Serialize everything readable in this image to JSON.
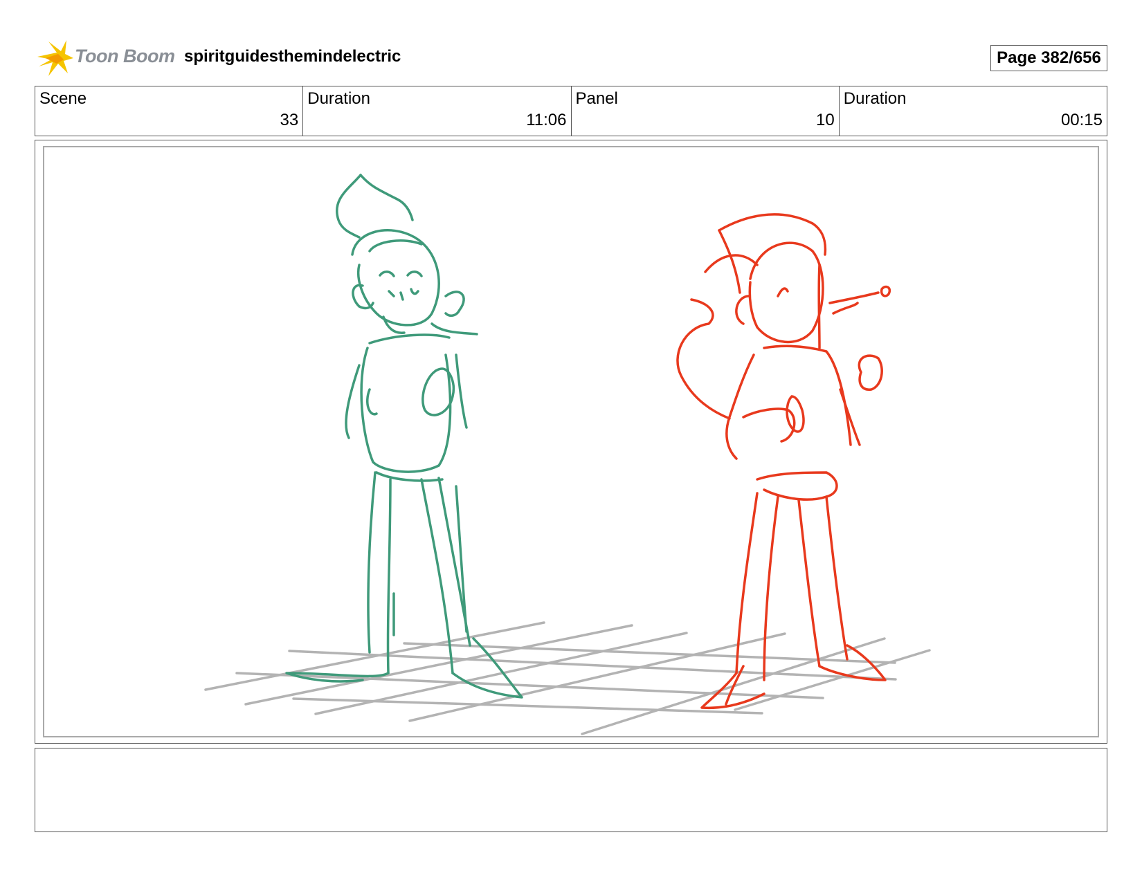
{
  "header": {
    "logo_text": "Toon Boom",
    "project_title": "spiritguidesthemindelectric",
    "page_label": "Page 382/656"
  },
  "info": {
    "scene_label": "Scene",
    "scene_value": "33",
    "scene_duration_label": "Duration",
    "scene_duration_value": "11:06",
    "panel_label": "Panel",
    "panel_value": "10",
    "panel_duration_label": "Duration",
    "panel_duration_value": "00:15"
  },
  "colors": {
    "green_sketch": "#3f9a7a",
    "red_sketch": "#e8391d",
    "grid": "#b3b3b3",
    "logo_yellow": "#f5c400"
  }
}
